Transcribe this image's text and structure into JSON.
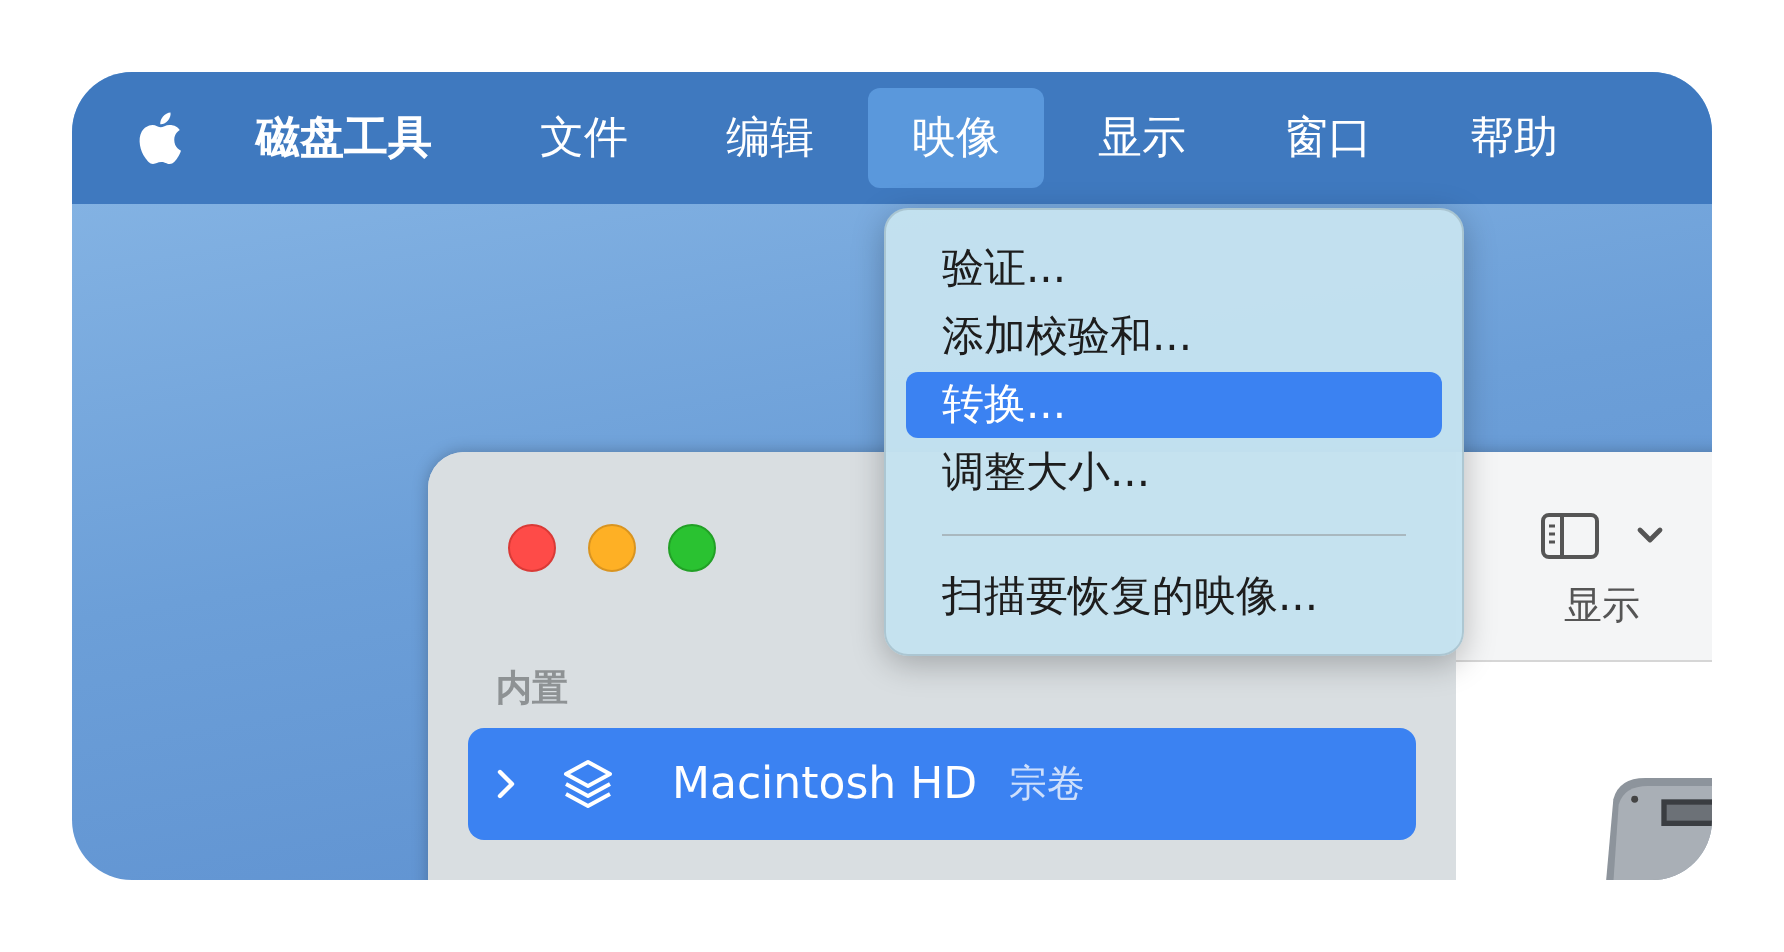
{
  "menu_bar": {
    "app_name": "磁盘工具",
    "items": [
      {
        "label": "文件",
        "selected": false
      },
      {
        "label": "编辑",
        "selected": false
      },
      {
        "label": "映像",
        "selected": true
      },
      {
        "label": "显示",
        "selected": false
      },
      {
        "label": "窗口",
        "selected": false
      },
      {
        "label": "帮助",
        "selected": false
      }
    ]
  },
  "dropdown_menu": {
    "items": [
      {
        "kind": "item",
        "label": "验证...",
        "selected": false
      },
      {
        "kind": "item",
        "label": "添加校验和...",
        "selected": false
      },
      {
        "kind": "item",
        "label": "转换...",
        "selected": true
      },
      {
        "kind": "item",
        "label": "调整大小...",
        "selected": false
      },
      {
        "kind": "separator"
      },
      {
        "kind": "item",
        "label": "扫描要恢复的映像...",
        "selected": false
      }
    ]
  },
  "window": {
    "sidebar": {
      "section": "内置",
      "items": [
        {
          "name": "Macintosh HD",
          "detail": "宗卷",
          "selected": true,
          "expanded": false
        }
      ]
    },
    "toolbar": {
      "view_label": "显示"
    }
  }
}
